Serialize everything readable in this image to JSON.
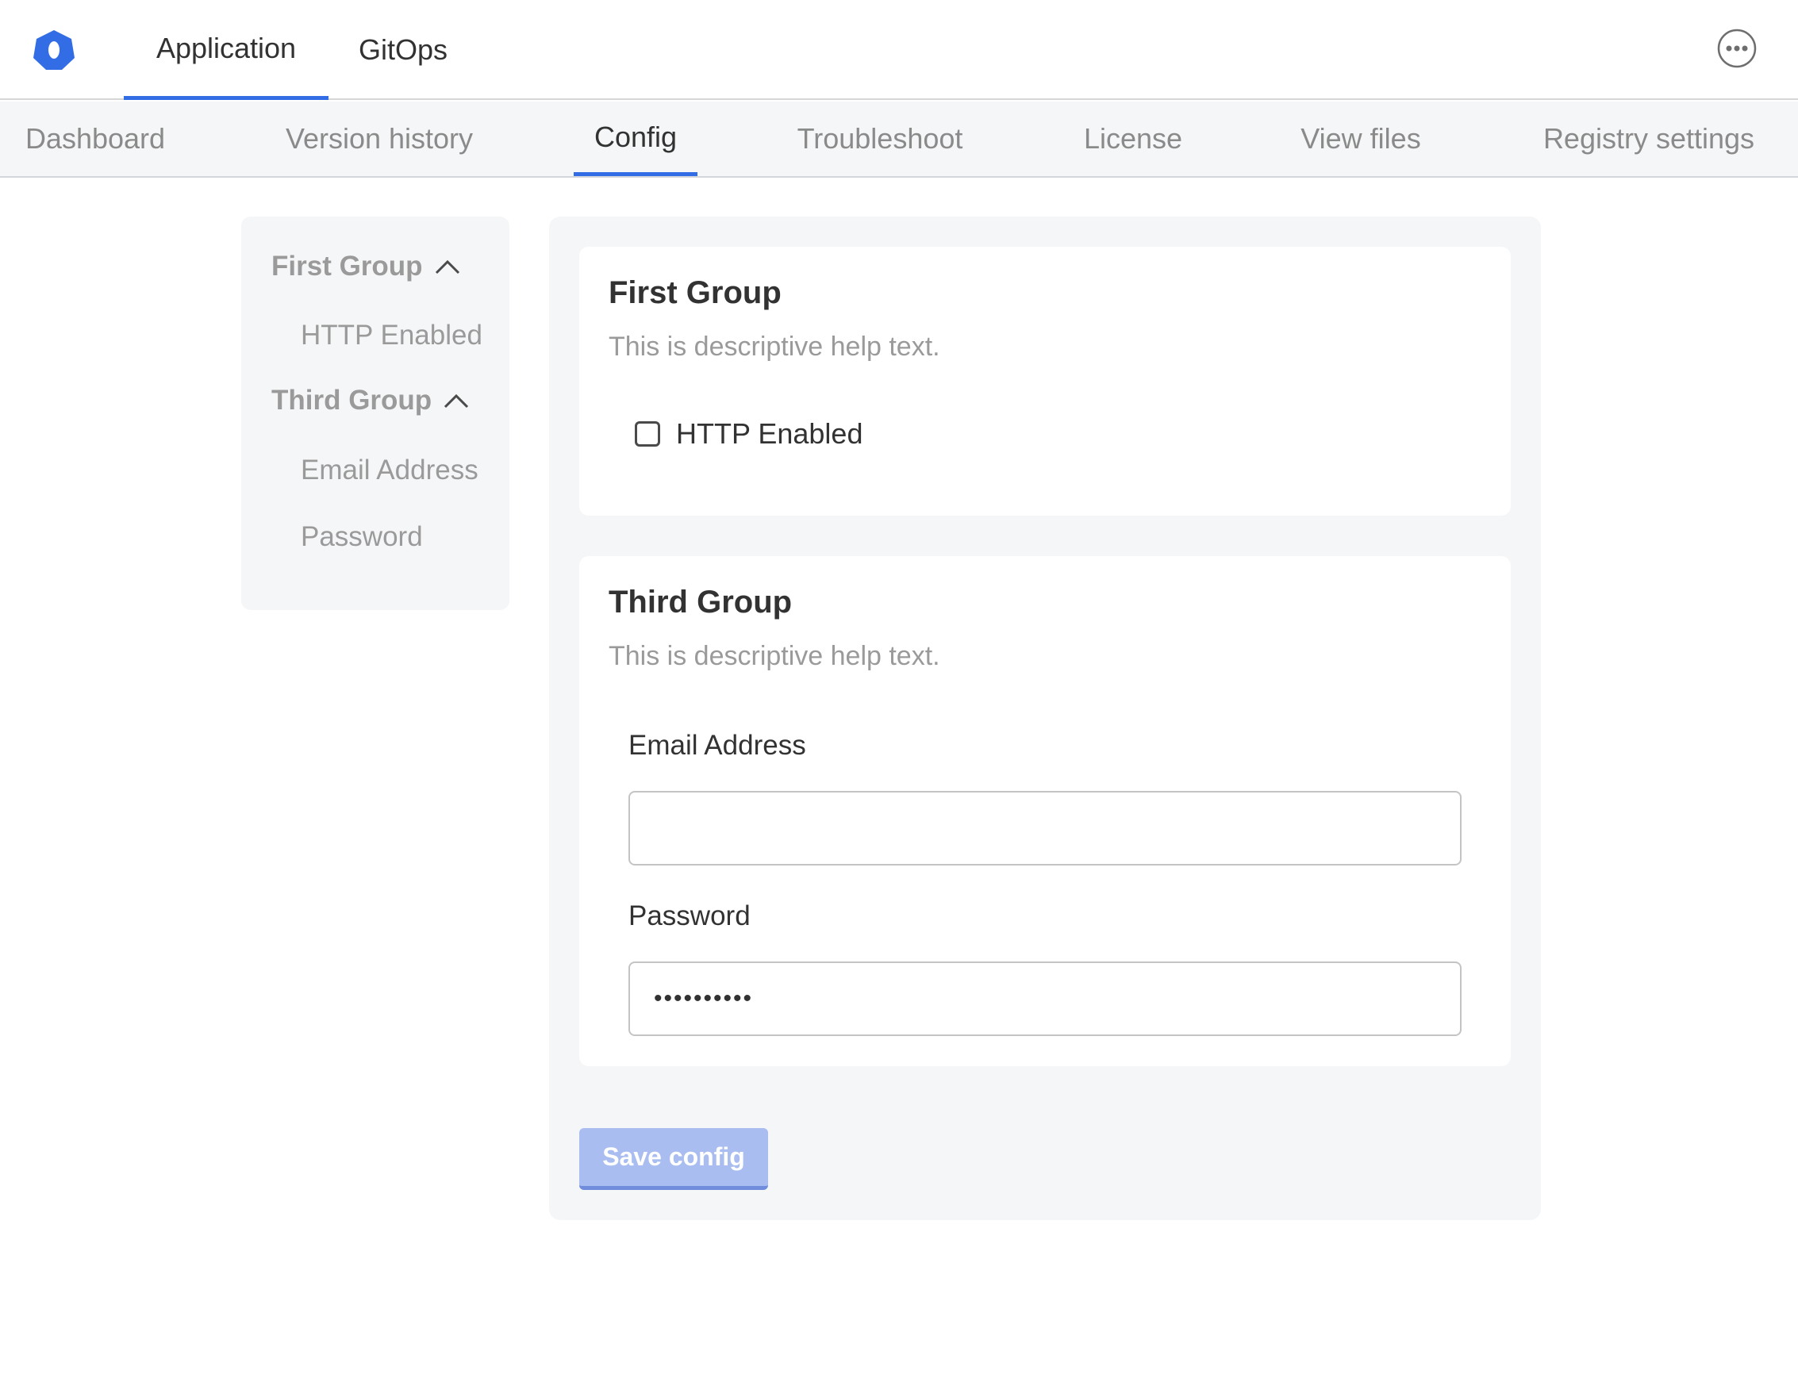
{
  "top_nav": {
    "logo_icon": "hexagon-logo-icon",
    "tabs": [
      {
        "label": "Application",
        "active": true
      },
      {
        "label": "GitOps",
        "active": false
      }
    ],
    "more_icon": "more-horizontal-icon"
  },
  "sub_nav": {
    "tabs": [
      {
        "label": "Dashboard",
        "active": false
      },
      {
        "label": "Version history",
        "active": false
      },
      {
        "label": "Config",
        "active": true
      },
      {
        "label": "Troubleshoot",
        "active": false
      },
      {
        "label": "License",
        "active": false
      },
      {
        "label": "View files",
        "active": false
      },
      {
        "label": "Registry settings",
        "active": false
      }
    ]
  },
  "config_nav": {
    "groups": [
      {
        "label": "First Group",
        "expanded": true,
        "items": [
          "HTTP Enabled"
        ]
      },
      {
        "label": "Third Group",
        "expanded": true,
        "items": [
          "Email Address",
          "Password"
        ]
      }
    ]
  },
  "config": {
    "groups": [
      {
        "title": "First Group",
        "help": "This is descriptive help text.",
        "checkbox": {
          "label": "HTTP Enabled",
          "checked": false
        }
      },
      {
        "title": "Third Group",
        "help": "This is descriptive help text.",
        "fields": [
          {
            "label": "Email Address",
            "value": ""
          },
          {
            "label": "Password",
            "value": "••••••••••"
          }
        ]
      }
    ],
    "save_label": "Save config"
  },
  "colors": {
    "accent": "#326de6",
    "save_button_disabled": "#a9bdf1",
    "muted_text": "#9a9a9a"
  }
}
